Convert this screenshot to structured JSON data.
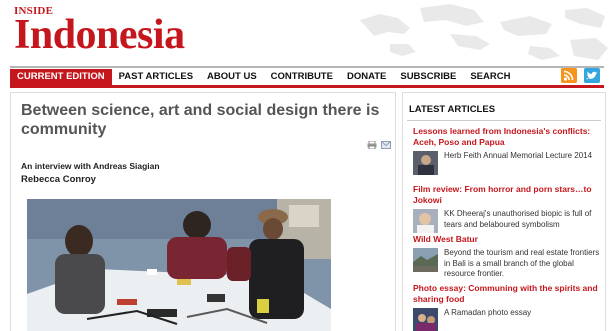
{
  "site": {
    "logo_small": "INSIDE",
    "logo_big": "Indonesia"
  },
  "nav": {
    "items": [
      {
        "label": "CURRENT EDITION",
        "active": true
      },
      {
        "label": "PAST ARTICLES"
      },
      {
        "label": "ABOUT US"
      },
      {
        "label": "CONTRIBUTE"
      },
      {
        "label": "DONATE"
      },
      {
        "label": "SUBSCRIBE"
      },
      {
        "label": "SEARCH"
      }
    ],
    "icons": [
      "rss-icon",
      "twitter-icon"
    ],
    "accent": "#c4161c"
  },
  "article": {
    "title": "Between science, art and social design there is community",
    "subtitle": "An interview with Andreas Siagian",
    "author": "Rebecca Conroy"
  },
  "sidebar": {
    "heading": "LATEST ARTICLES",
    "items": [
      {
        "title": "Lessons learned from Indonesia's conflicts: Aceh, Poso and Papua",
        "desc": "Herb Feith Annual Memorial Lecture 2014"
      },
      {
        "title": "Film review: From horror and porn stars…to Jokowi",
        "desc": "KK Dheeraj's unauthorised biopic is full of tears and belaboured symbolism"
      },
      {
        "title": "Wild West Batur",
        "desc": "Beyond the tourism and real estate frontiers in Bali is a small branch of the global resource frontier."
      },
      {
        "title": "Photo essay: Communing with the spirits and sharing food",
        "desc": "A Ramadan photo essay"
      }
    ]
  }
}
